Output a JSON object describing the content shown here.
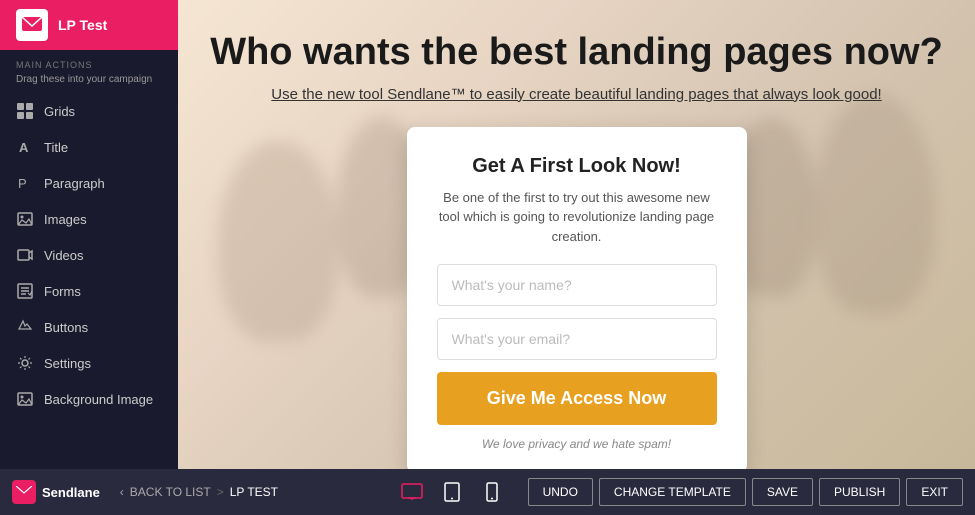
{
  "sidebar": {
    "logo_text": "LP Test",
    "section_label": "MAIN ACTIONS",
    "section_sublabel": "Drag these into your campaign",
    "items": [
      {
        "id": "grids",
        "label": "Grids",
        "icon": "grid"
      },
      {
        "id": "title",
        "label": "Title",
        "icon": "title"
      },
      {
        "id": "paragraph",
        "label": "Paragraph",
        "icon": "paragraph"
      },
      {
        "id": "images",
        "label": "Images",
        "icon": "image"
      },
      {
        "id": "videos",
        "label": "Videos",
        "icon": "video"
      },
      {
        "id": "forms",
        "label": "Forms",
        "icon": "form"
      },
      {
        "id": "buttons",
        "label": "Buttons",
        "icon": "button"
      },
      {
        "id": "settings",
        "label": "Settings",
        "icon": "settings"
      },
      {
        "id": "background-image",
        "label": "Background Image",
        "icon": "bg-image"
      }
    ]
  },
  "canvas": {
    "headline_prefix": "Who wants the ",
    "headline_bold": "best landing pages",
    "headline_suffix": " now?",
    "subtext_prefix": "Use the new tool Sendlane™ to easily create beautiful landing pages that ",
    "subtext_underline": "always",
    "subtext_suffix": " look good!"
  },
  "form_card": {
    "title": "Get A First Look Now!",
    "description": "Be one of the first to try out this awesome new tool which is going to revolutionize landing page creation.",
    "name_placeholder": "What's your name?",
    "email_placeholder": "What's your email?",
    "submit_label": "Give Me Access Now",
    "privacy_text": "We love privacy and we hate spam!"
  },
  "bottom_bar": {
    "logo_text": "Sendlane",
    "back_to_list": "BACK TO LIST",
    "current_page": "LP TEST",
    "undo_label": "UNDO",
    "change_template_label": "CHANGE TEMPLATE",
    "save_label": "SAVE",
    "publish_label": "PUBLISH",
    "exit_label": "EXIT"
  },
  "colors": {
    "brand_pink": "#e91e63",
    "submit_orange": "#e8a020",
    "sidebar_bg": "#1a1a2e",
    "bottom_bar_bg": "#2a2a3e"
  }
}
